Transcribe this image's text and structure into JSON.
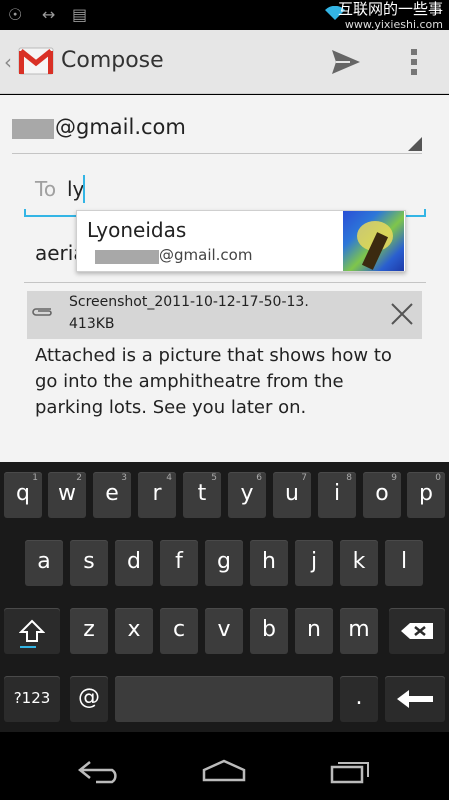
{
  "status_bar": {
    "watermark_site": "互联网的一些事",
    "watermark_url": "www.yixieshi.com"
  },
  "action_bar": {
    "title": "Compose"
  },
  "compose": {
    "from": "@gmail.com",
    "to_label": "To",
    "to_value": "ly",
    "subject_value": "aeria",
    "suggestion": {
      "name": "Lyoneidas",
      "email": "@gmail.com"
    },
    "attachment": {
      "name": "Screenshot_2011-10-12-17-50-13.",
      "size": "413KB"
    },
    "body": "Attached is a picture that shows how to go into the amphitheatre from the parking lots. See you later on."
  },
  "keyboard": {
    "row1": [
      "q",
      "w",
      "e",
      "r",
      "t",
      "y",
      "u",
      "i",
      "o",
      "p"
    ],
    "row1_hints": [
      "1",
      "2",
      "3",
      "4",
      "5",
      "6",
      "7",
      "8",
      "9",
      "0"
    ],
    "row2": [
      "a",
      "s",
      "d",
      "f",
      "g",
      "h",
      "j",
      "k",
      "l"
    ],
    "row3": [
      "z",
      "x",
      "c",
      "v",
      "b",
      "n",
      "m"
    ],
    "symbols_label": "?123",
    "at_label": "@",
    "period_label": "."
  }
}
